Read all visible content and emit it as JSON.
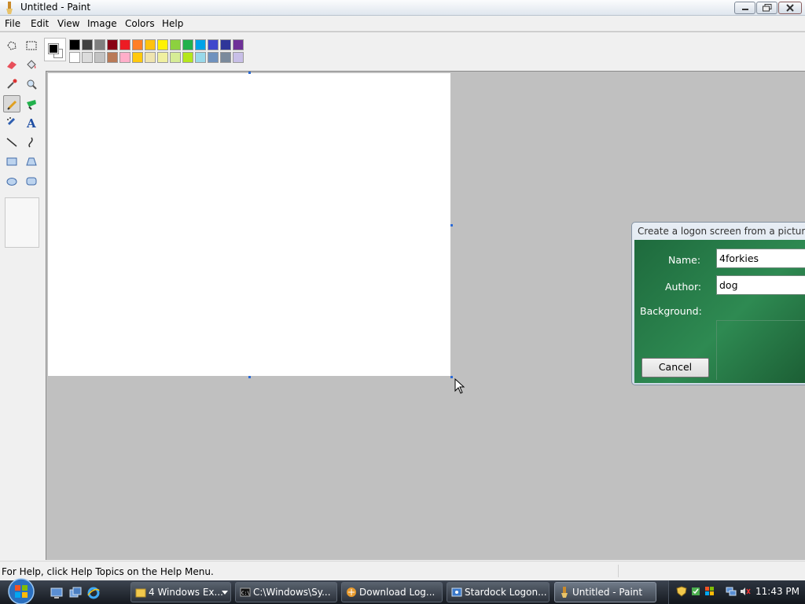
{
  "window": {
    "title": "Untitled - Paint"
  },
  "menu": [
    "File",
    "Edit",
    "View",
    "Image",
    "Colors",
    "Help"
  ],
  "palette": {
    "foreground": "#000000",
    "background": "#ffffff",
    "row1": [
      "#000000",
      "#404040",
      "#7f7f7f",
      "#880015",
      "#ed1c24",
      "#ff7f27",
      "#ffc20e",
      "#fff200",
      "#8cd13f",
      "#22b14c",
      "#00a2e8",
      "#3f48cc",
      "#2f3699",
      "#6f3198"
    ],
    "row2": [
      "#ffffff",
      "#dcdcdc",
      "#c3c3c3",
      "#b97a57",
      "#ffaec9",
      "#ffc90e",
      "#efe4b0",
      "#f0f0a0",
      "#d6ec96",
      "#b5e61d",
      "#99d9ea",
      "#7092be",
      "#7b8a9c",
      "#c8bfe7"
    ]
  },
  "tools": [
    "free-select",
    "rect-select",
    "eraser",
    "fill",
    "color-picker",
    "magnifier",
    "pencil",
    "brush",
    "airbrush",
    "text",
    "line",
    "curve",
    "rectangle",
    "polygon",
    "ellipse",
    "rounded-rectangle"
  ],
  "dialog": {
    "title": "Create a logon screen from a picture",
    "name_label": "Name:",
    "name_value": "4forkies",
    "author_label": "Author:",
    "author_value": "dog",
    "background_label": "Background:",
    "cancel_label": "Cancel",
    "accent": "#2e8a52"
  },
  "status": {
    "text": "For Help, click Help Topics on the Help Menu."
  },
  "taskbar": {
    "tasks": [
      {
        "label": "4 Windows Ex..."
      },
      {
        "label": "C:\\Windows\\Sy..."
      },
      {
        "label": "Download Log..."
      },
      {
        "label": "Stardock Logon..."
      },
      {
        "label": "Untitled - Paint"
      }
    ],
    "clock": "11:43 PM"
  }
}
